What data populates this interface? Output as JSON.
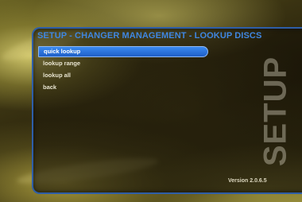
{
  "screen": {
    "title": "SETUP - CHANGER MANAGEMENT - LOOKUP DISCS",
    "watermark": "SETUP",
    "version": "Version 2.0.6.5"
  },
  "menu": {
    "selected_index": 0,
    "items": [
      {
        "label": "quick lookup"
      },
      {
        "label": "lookup range"
      },
      {
        "label": "lookup all"
      },
      {
        "label": "back"
      }
    ]
  },
  "colors": {
    "title_blue": "#3f86e0",
    "highlight_blue": "#2a74e0",
    "panel_border": "#2e5ea8",
    "text_light": "#e8e4d0"
  }
}
